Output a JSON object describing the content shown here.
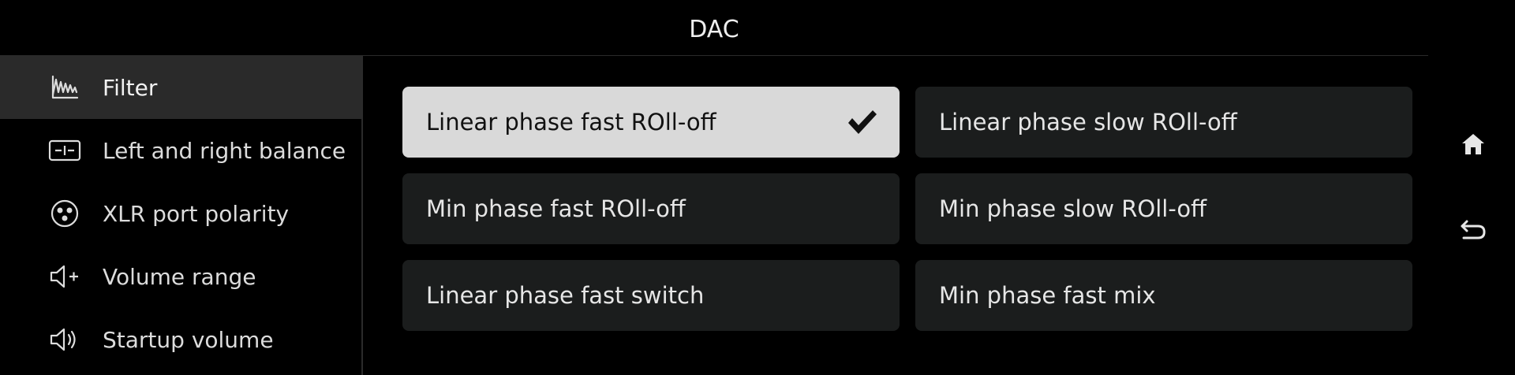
{
  "header": {
    "title": "DAC"
  },
  "sidebar": {
    "items": [
      {
        "label": "Filter",
        "icon": "waveform-icon",
        "active": true
      },
      {
        "label": "Left and right balance",
        "icon": "balance-icon",
        "active": false
      },
      {
        "label": "XLR port polarity",
        "icon": "xlr-connector-icon",
        "active": false
      },
      {
        "label": "Volume range",
        "icon": "volume-plus-icon",
        "active": false
      },
      {
        "label": "Startup volume",
        "icon": "speaker-icon",
        "active": false
      }
    ]
  },
  "filter_options": [
    {
      "label": "Linear phase fast ROll-off",
      "selected": true
    },
    {
      "label": "Linear phase slow ROll-off",
      "selected": false
    },
    {
      "label": "Min phase fast ROll-off",
      "selected": false
    },
    {
      "label": "Min phase slow ROll-off",
      "selected": false
    },
    {
      "label": "Linear phase fast switch",
      "selected": false
    },
    {
      "label": "Min phase fast mix",
      "selected": false
    }
  ],
  "right_nav": {
    "home_icon": "home-icon",
    "back_icon": "back-icon"
  },
  "colors": {
    "background": "#000000",
    "sidebar_active": "#2a2a2a",
    "option_bg": "#1b1d1d",
    "option_selected_bg": "#d9d9d9"
  }
}
